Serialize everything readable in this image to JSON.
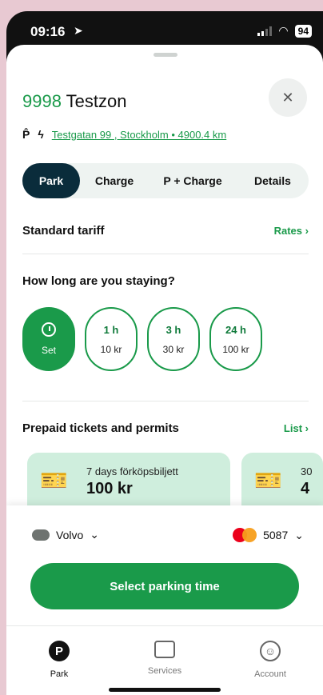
{
  "status": {
    "time": "09:16",
    "battery": "94"
  },
  "zone": {
    "code": "9998",
    "name": "Testzon",
    "address": "Testgatan 99 , Stockholm • 4900.4 km"
  },
  "tabs": [
    "Park",
    "Charge",
    "P + Charge",
    "Details"
  ],
  "tariff": {
    "label": "Standard tariff",
    "link": "Rates"
  },
  "durations": {
    "question": "How long are you staying?",
    "set_label": "Set",
    "options": [
      {
        "hours": "1 h",
        "price": "10 kr"
      },
      {
        "hours": "3 h",
        "price": "30 kr"
      },
      {
        "hours": "24 h",
        "price": "100 kr"
      }
    ]
  },
  "prepaid": {
    "label": "Prepaid tickets and permits",
    "link": "List",
    "tickets": [
      {
        "name": "7 days förköpsbiljett",
        "price": "100 kr"
      },
      {
        "name": "30",
        "price": "4"
      }
    ]
  },
  "payment": {
    "vehicle": "Volvo",
    "card": "5087",
    "cta": "Select parking time"
  },
  "nav": [
    "Park",
    "Services",
    "Account"
  ],
  "colors": {
    "accent": "#1a9a4a",
    "tab_active": "#0a2c3b",
    "ticket_bg": "#cfeedd"
  },
  "icons": [
    "location-arrow-icon",
    "signal-icon",
    "wifi-icon",
    "close-icon",
    "parking-icon",
    "charging-icon",
    "clock-icon",
    "chevron-right-icon",
    "chevron-down-icon",
    "car-icon",
    "mastercard-icon",
    "services-icon",
    "account-icon"
  ]
}
